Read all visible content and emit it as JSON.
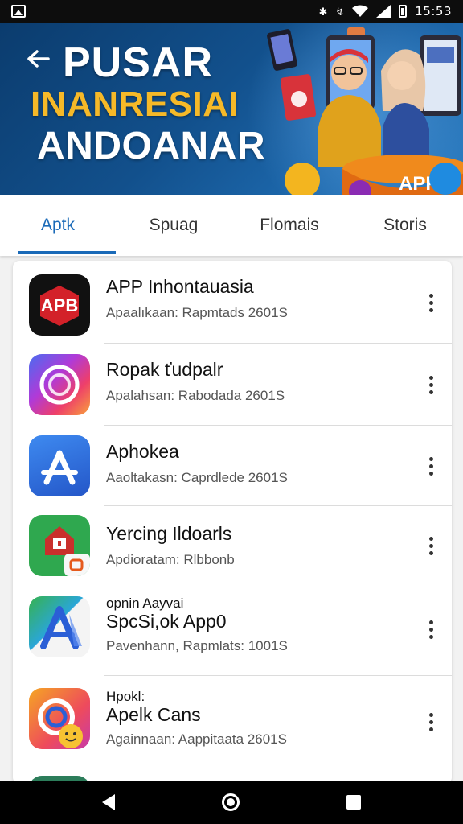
{
  "status_bar": {
    "time": "15:53",
    "icons": [
      "gallery-icon",
      "bluetooth-icon",
      "data-icon",
      "wifi-icon",
      "signal-icon",
      "battery-icon"
    ]
  },
  "banner": {
    "line1": "PUSAR",
    "line2": "INANRESIAI",
    "line3": "ANDOANAR",
    "badge_text": "APP",
    "colors": {
      "background": "#12508c",
      "accent": "#f6b928"
    }
  },
  "tabs": [
    {
      "label": "Aptk",
      "active": true
    },
    {
      "label": "Spuag",
      "active": false
    },
    {
      "label": "Flomais",
      "active": false
    },
    {
      "label": "Storis",
      "active": false
    }
  ],
  "apps": [
    {
      "prefix": "",
      "name": "APP Inhontauasia",
      "subtitle": "Apaalıkaan: Rapmtads 2601S",
      "icon": "apb-logo-icon",
      "icon_text": "APB"
    },
    {
      "prefix": "",
      "name": "Ropak ťudpalr",
      "subtitle": "Apalahsan: Rabodada 2601S",
      "icon": "camera-ring-icon"
    },
    {
      "prefix": "",
      "name": "Aphokea",
      "subtitle": "Aaoltakasn: Caprdlede 2601S",
      "icon": "app-store-a-icon"
    },
    {
      "prefix": "",
      "name": "Yercing Ildoarls",
      "subtitle": "Apdioratam: Rlbbonb",
      "icon": "house-map-icon"
    },
    {
      "prefix": "opnin Aayvai",
      "name": "SpcSi,ok App0",
      "subtitle": "Pavenhann, Rapmlats: 1001S",
      "icon": "vector-a-icon"
    },
    {
      "prefix": "Hpokl:",
      "name": "Apelk Cans",
      "subtitle": "Againnaan: Aappitaata 2601S",
      "icon": "circle-face-icon"
    }
  ],
  "nav_bar": {
    "icons": [
      "back-triangle-icon",
      "home-circle-icon",
      "recent-square-icon"
    ]
  }
}
